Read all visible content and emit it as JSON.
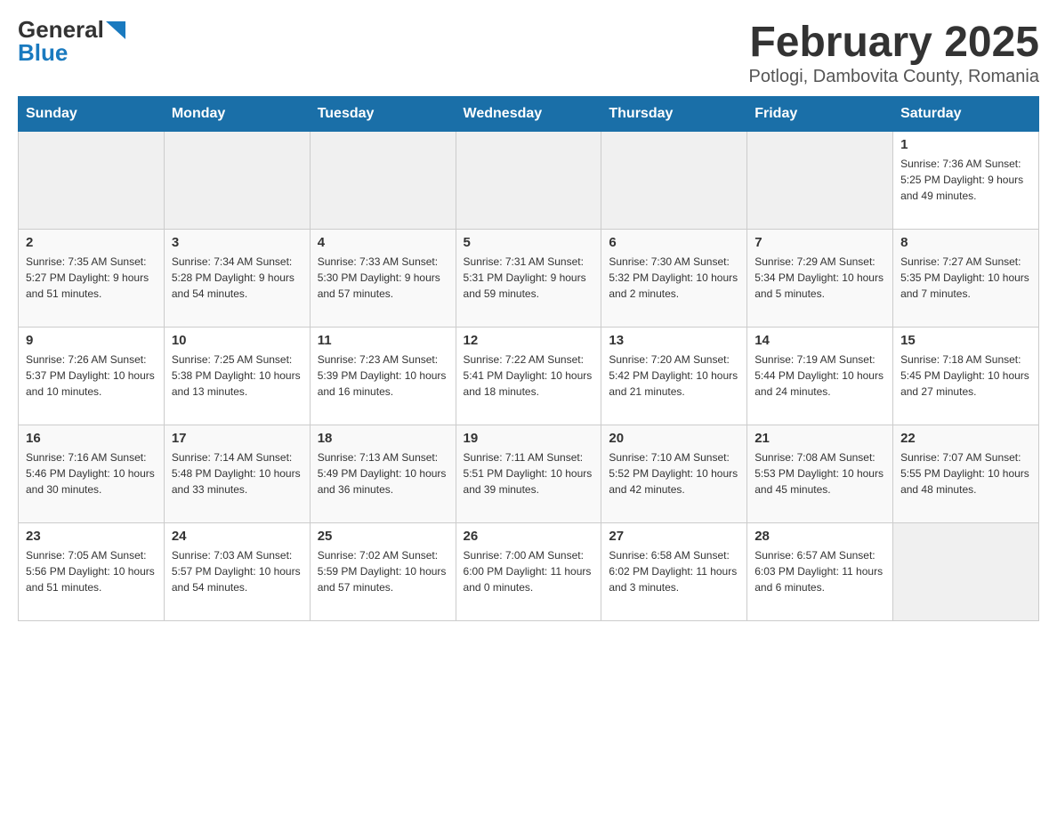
{
  "header": {
    "logo_general": "General",
    "logo_blue": "Blue",
    "month_title": "February 2025",
    "location": "Potlogi, Dambovita County, Romania"
  },
  "days_of_week": [
    "Sunday",
    "Monday",
    "Tuesday",
    "Wednesday",
    "Thursday",
    "Friday",
    "Saturday"
  ],
  "weeks": [
    [
      {
        "day": "",
        "info": ""
      },
      {
        "day": "",
        "info": ""
      },
      {
        "day": "",
        "info": ""
      },
      {
        "day": "",
        "info": ""
      },
      {
        "day": "",
        "info": ""
      },
      {
        "day": "",
        "info": ""
      },
      {
        "day": "1",
        "info": "Sunrise: 7:36 AM\nSunset: 5:25 PM\nDaylight: 9 hours and 49 minutes."
      }
    ],
    [
      {
        "day": "2",
        "info": "Sunrise: 7:35 AM\nSunset: 5:27 PM\nDaylight: 9 hours and 51 minutes."
      },
      {
        "day": "3",
        "info": "Sunrise: 7:34 AM\nSunset: 5:28 PM\nDaylight: 9 hours and 54 minutes."
      },
      {
        "day": "4",
        "info": "Sunrise: 7:33 AM\nSunset: 5:30 PM\nDaylight: 9 hours and 57 minutes."
      },
      {
        "day": "5",
        "info": "Sunrise: 7:31 AM\nSunset: 5:31 PM\nDaylight: 9 hours and 59 minutes."
      },
      {
        "day": "6",
        "info": "Sunrise: 7:30 AM\nSunset: 5:32 PM\nDaylight: 10 hours and 2 minutes."
      },
      {
        "day": "7",
        "info": "Sunrise: 7:29 AM\nSunset: 5:34 PM\nDaylight: 10 hours and 5 minutes."
      },
      {
        "day": "8",
        "info": "Sunrise: 7:27 AM\nSunset: 5:35 PM\nDaylight: 10 hours and 7 minutes."
      }
    ],
    [
      {
        "day": "9",
        "info": "Sunrise: 7:26 AM\nSunset: 5:37 PM\nDaylight: 10 hours and 10 minutes."
      },
      {
        "day": "10",
        "info": "Sunrise: 7:25 AM\nSunset: 5:38 PM\nDaylight: 10 hours and 13 minutes."
      },
      {
        "day": "11",
        "info": "Sunrise: 7:23 AM\nSunset: 5:39 PM\nDaylight: 10 hours and 16 minutes."
      },
      {
        "day": "12",
        "info": "Sunrise: 7:22 AM\nSunset: 5:41 PM\nDaylight: 10 hours and 18 minutes."
      },
      {
        "day": "13",
        "info": "Sunrise: 7:20 AM\nSunset: 5:42 PM\nDaylight: 10 hours and 21 minutes."
      },
      {
        "day": "14",
        "info": "Sunrise: 7:19 AM\nSunset: 5:44 PM\nDaylight: 10 hours and 24 minutes."
      },
      {
        "day": "15",
        "info": "Sunrise: 7:18 AM\nSunset: 5:45 PM\nDaylight: 10 hours and 27 minutes."
      }
    ],
    [
      {
        "day": "16",
        "info": "Sunrise: 7:16 AM\nSunset: 5:46 PM\nDaylight: 10 hours and 30 minutes."
      },
      {
        "day": "17",
        "info": "Sunrise: 7:14 AM\nSunset: 5:48 PM\nDaylight: 10 hours and 33 minutes."
      },
      {
        "day": "18",
        "info": "Sunrise: 7:13 AM\nSunset: 5:49 PM\nDaylight: 10 hours and 36 minutes."
      },
      {
        "day": "19",
        "info": "Sunrise: 7:11 AM\nSunset: 5:51 PM\nDaylight: 10 hours and 39 minutes."
      },
      {
        "day": "20",
        "info": "Sunrise: 7:10 AM\nSunset: 5:52 PM\nDaylight: 10 hours and 42 minutes."
      },
      {
        "day": "21",
        "info": "Sunrise: 7:08 AM\nSunset: 5:53 PM\nDaylight: 10 hours and 45 minutes."
      },
      {
        "day": "22",
        "info": "Sunrise: 7:07 AM\nSunset: 5:55 PM\nDaylight: 10 hours and 48 minutes."
      }
    ],
    [
      {
        "day": "23",
        "info": "Sunrise: 7:05 AM\nSunset: 5:56 PM\nDaylight: 10 hours and 51 minutes."
      },
      {
        "day": "24",
        "info": "Sunrise: 7:03 AM\nSunset: 5:57 PM\nDaylight: 10 hours and 54 minutes."
      },
      {
        "day": "25",
        "info": "Sunrise: 7:02 AM\nSunset: 5:59 PM\nDaylight: 10 hours and 57 minutes."
      },
      {
        "day": "26",
        "info": "Sunrise: 7:00 AM\nSunset: 6:00 PM\nDaylight: 11 hours and 0 minutes."
      },
      {
        "day": "27",
        "info": "Sunrise: 6:58 AM\nSunset: 6:02 PM\nDaylight: 11 hours and 3 minutes."
      },
      {
        "day": "28",
        "info": "Sunrise: 6:57 AM\nSunset: 6:03 PM\nDaylight: 11 hours and 6 minutes."
      },
      {
        "day": "",
        "info": ""
      }
    ]
  ]
}
